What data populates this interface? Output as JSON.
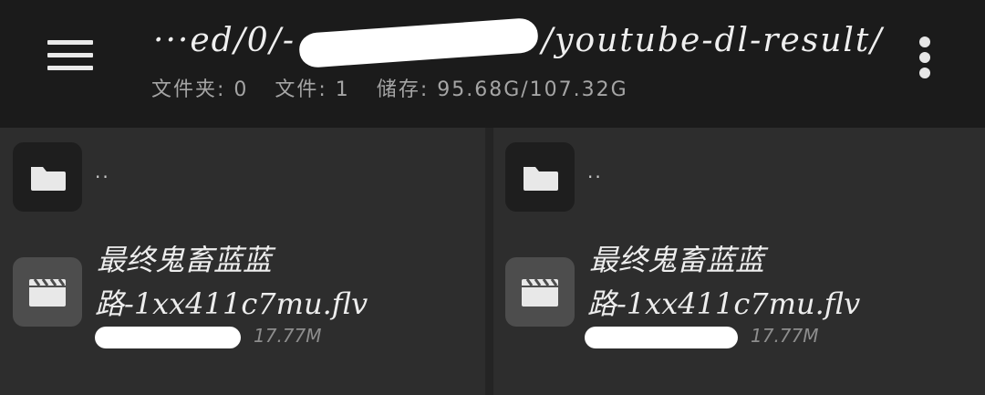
{
  "toolbar": {
    "path_prefix": "···ed/0/-",
    "path_suffix": "/youtube-dl-result/",
    "folders": "文件夹: 0",
    "files": "文件: 1",
    "storage": "储存: 95.68G/107.32G",
    "icons": [
      "menu-icon",
      "more-vert-icon"
    ]
  },
  "panes": [
    {
      "updir": "..",
      "file": {
        "name_line1": "最终鬼畜蓝蓝",
        "name_line2": "路-1xx411c7mu.flv",
        "size": "17.77M"
      }
    },
    {
      "updir": "..",
      "file": {
        "name_line1": "最终鬼畜蓝蓝",
        "name_line2": "路-1xx411c7mu.flv",
        "size": "17.77M"
      }
    }
  ],
  "colors": {
    "toolbar_bg": "#1b1b1b",
    "pane_bg": "#2d2d2d",
    "folder_tile": "#1e1e1e",
    "video_tile": "#4d4d4d"
  }
}
